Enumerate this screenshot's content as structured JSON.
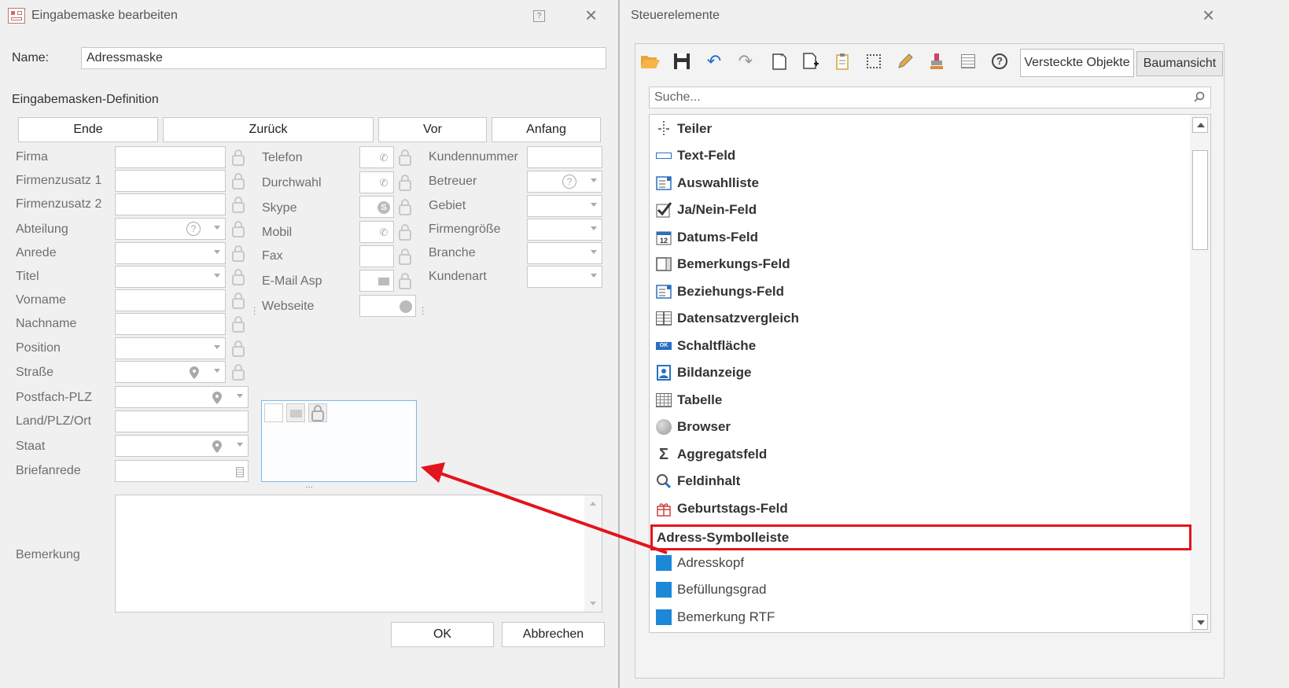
{
  "left_window": {
    "title": "Eingabemaske bearbeiten",
    "name_label": "Name:",
    "name_value": "Adressmaske",
    "section_label": "Eingabemasken-Definition",
    "nav_buttons": [
      "Ende",
      "Zurück",
      "Vor",
      "Anfang"
    ],
    "col1_labels": [
      "Firma",
      "Firmenzusatz 1",
      "Firmenzusatz 2",
      "Abteilung",
      "Anrede",
      "Titel",
      "Vorname",
      "Nachname",
      "Position",
      "Straße",
      "Postfach-PLZ",
      "Land/PLZ/Ort",
      "Staat",
      "Briefanrede"
    ],
    "col2_labels": [
      "Telefon",
      "Durchwahl",
      "Skype",
      "Mobil",
      "Fax",
      "E-Mail Asp",
      "Webseite"
    ],
    "col3_labels": [
      "Kundennummer",
      "Betreuer",
      "Gebiet",
      "Firmengröße",
      "Branche",
      "Kundenart"
    ],
    "remark_label": "Bemerkung",
    "ok_label": "OK",
    "cancel_label": "Abbrechen"
  },
  "right_window": {
    "title": "Steuerelemente",
    "tabs": [
      "Versteckte Objekte",
      "Baumansicht"
    ],
    "search_placeholder": "Suche...",
    "items": [
      "Teiler",
      "Text-Feld",
      "Auswahlliste",
      "Ja/Nein-Feld",
      "Datums-Feld",
      "Bemerkungs-Feld",
      "Beziehungs-Feld",
      "Datensatzvergleich",
      "Schaltfläche",
      "Bildanzeige",
      "Tabelle",
      "Browser",
      "Aggregatsfeld",
      "Feldinhalt",
      "Geburtstags-Feld",
      "Adress-Symbolleiste"
    ],
    "plain_items": [
      "Adresskopf",
      "Befüllungsgrad",
      "Bemerkung RTF"
    ],
    "highlight_color": "#e3141b",
    "accent_color": "#1e88d8"
  }
}
